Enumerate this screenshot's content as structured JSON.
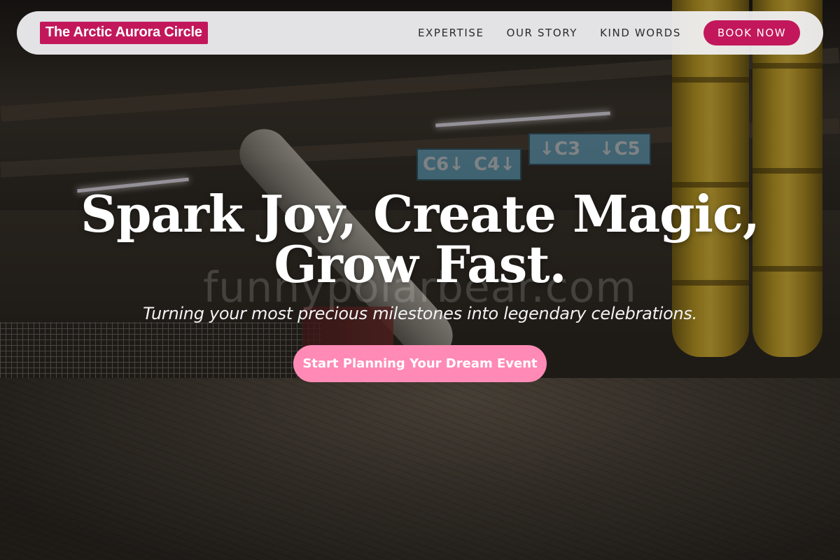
{
  "header": {
    "brand": "The Arctic Aurora Circle",
    "nav": [
      {
        "label": "EXPERTISE"
      },
      {
        "label": "OUR STORY"
      },
      {
        "label": "KIND WORDS"
      }
    ],
    "book_label": "BOOK NOW"
  },
  "hero": {
    "title_line1": "Spark Joy, Create Magic,",
    "title_line2": "Grow Fast.",
    "subtitle": "Turning your most precious milestones into legendary celebrations.",
    "cta_label": "Start Planning Your Dream Event"
  },
  "watermark": "funnypolarbear.com",
  "background": {
    "signs": [
      "C6↓",
      "C4↓",
      "↓C3",
      "↓C5"
    ]
  },
  "colors": {
    "brand": "#c2185b",
    "cta": "#ff8ab5",
    "header_bg": "#f0f0f2"
  }
}
